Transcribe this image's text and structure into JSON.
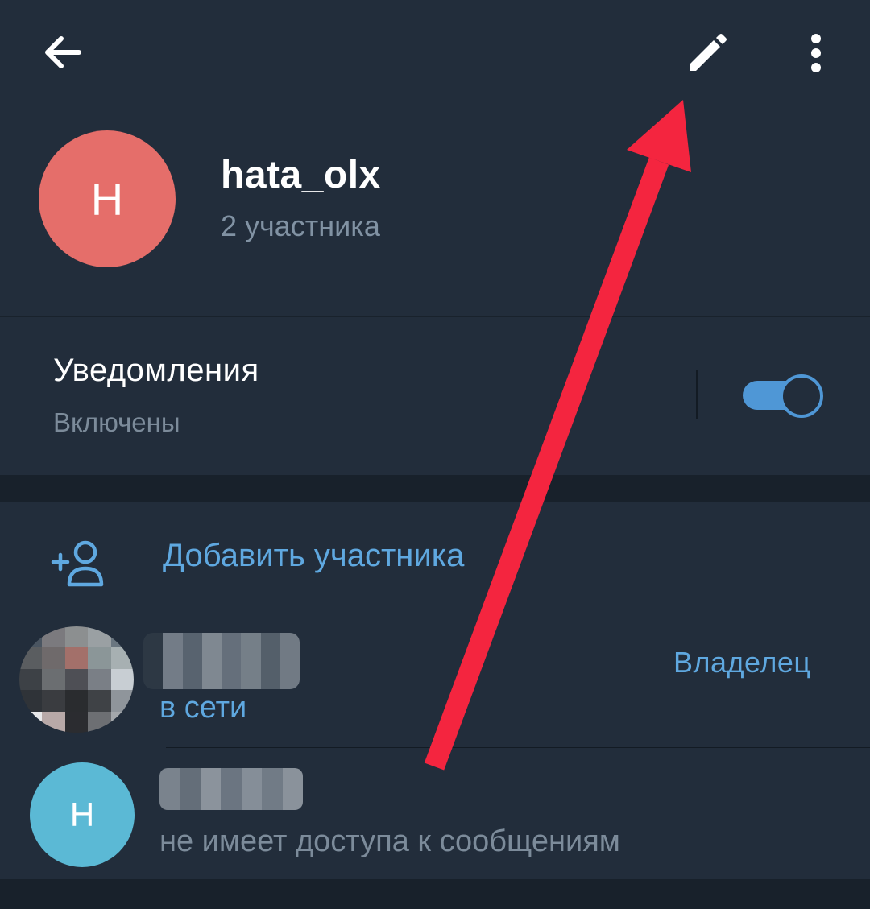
{
  "header": {
    "back_icon": "arrow-left-icon",
    "edit_icon": "pencil-icon",
    "more_icon": "more-vertical-icon",
    "title": "hata_olx",
    "subtitle": "2 участника",
    "avatar_letter": "H",
    "avatar_color": "#e56e6a"
  },
  "notifications": {
    "title": "Уведомления",
    "status": "Включены",
    "toggle_on": true,
    "accent": "#4f97d6"
  },
  "members": {
    "add_label": "Добавить участника",
    "add_icon": "add-person-icon",
    "list": [
      {
        "status": "в сети",
        "role": "Владелец",
        "avatar": "pixelated-photo"
      },
      {
        "status": "не имеет доступа к сообщениям",
        "avatar_letter": "H",
        "avatar_color": "#5bb9d5"
      }
    ]
  },
  "colors": {
    "background": "#1d2733",
    "card": "#222d3b",
    "link_blue": "#5fa8e0",
    "muted_text": "#7c8b9a",
    "annotation_arrow": "#f4253f"
  }
}
